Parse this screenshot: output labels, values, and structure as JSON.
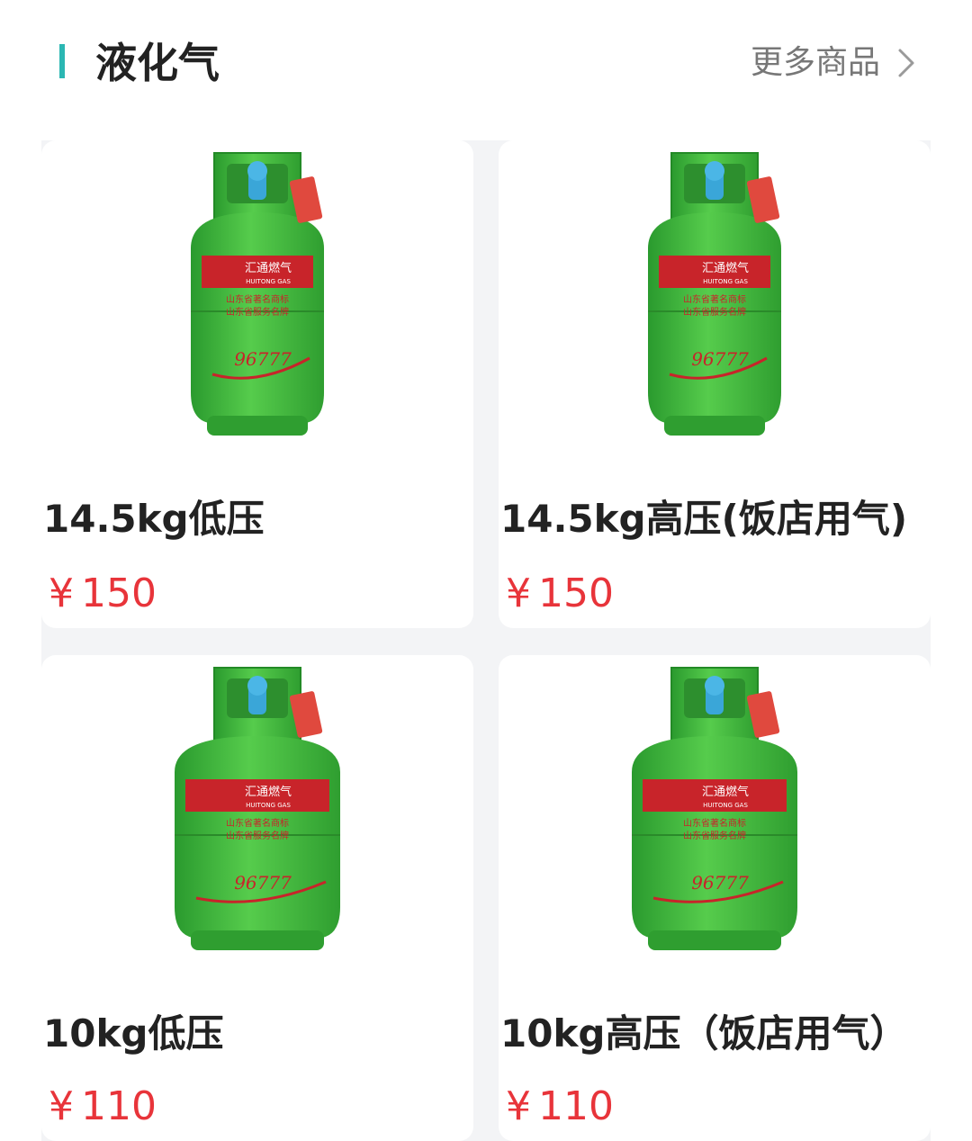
{
  "section": {
    "title": "液化气",
    "more_label": "更多商品",
    "accent_color": "#2bb7b3"
  },
  "products": [
    {
      "name": "14.5kg低压",
      "currency": "¥",
      "price": "150",
      "image": "green-gas-cylinder-14.5kg"
    },
    {
      "name": "14.5kg高压(饭店用气)",
      "currency": "¥",
      "price": "150",
      "image": "green-gas-cylinder-14.5kg"
    },
    {
      "name": "10kg低压",
      "currency": "¥",
      "price": "110",
      "image": "green-gas-cylinder-10kg"
    },
    {
      "name": "10kg高压（饭店用气）",
      "currency": "¥",
      "price": "110",
      "image": "green-gas-cylinder-10kg"
    }
  ],
  "colors": {
    "price": "#e8343a",
    "cylinder": "#3cb43c",
    "label": "#c8242a"
  },
  "cylinder_text": {
    "brand_cn": "汇通燃气",
    "brand_en": "HUITONG GAS",
    "line1": "山东省著名商标",
    "line2": "山东省服务名牌",
    "phone": "96777"
  }
}
